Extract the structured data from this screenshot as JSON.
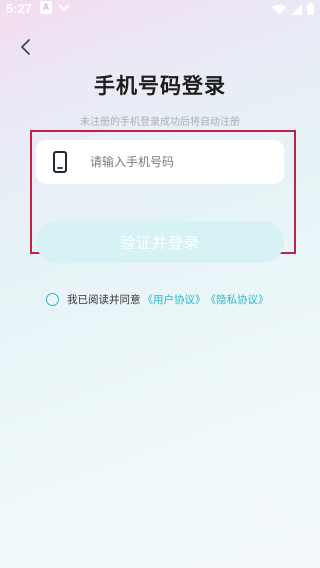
{
  "status_bar": {
    "time": "5:27",
    "icons": [
      "notification-a-icon",
      "notification-b-icon",
      "wifi-icon",
      "signal-icon",
      "battery-icon"
    ]
  },
  "nav": {
    "back_icon": "chevron-left-icon"
  },
  "login": {
    "title": "手机号码登录",
    "subtitle": "未注册的手机登录成功后将自动注册",
    "phone_placeholder": "请输入手机号码",
    "phone_value": "",
    "submit_label": "验证并登录",
    "agree_checked": false,
    "agree_text": "我已阅读并同意",
    "user_agreement": "《用户协议》",
    "privacy_policy": "《隐私协议》"
  },
  "colors": {
    "accent": "#2ab9c9",
    "button_disabled": "#d6f2f5",
    "highlight_border": "#c2224a"
  }
}
